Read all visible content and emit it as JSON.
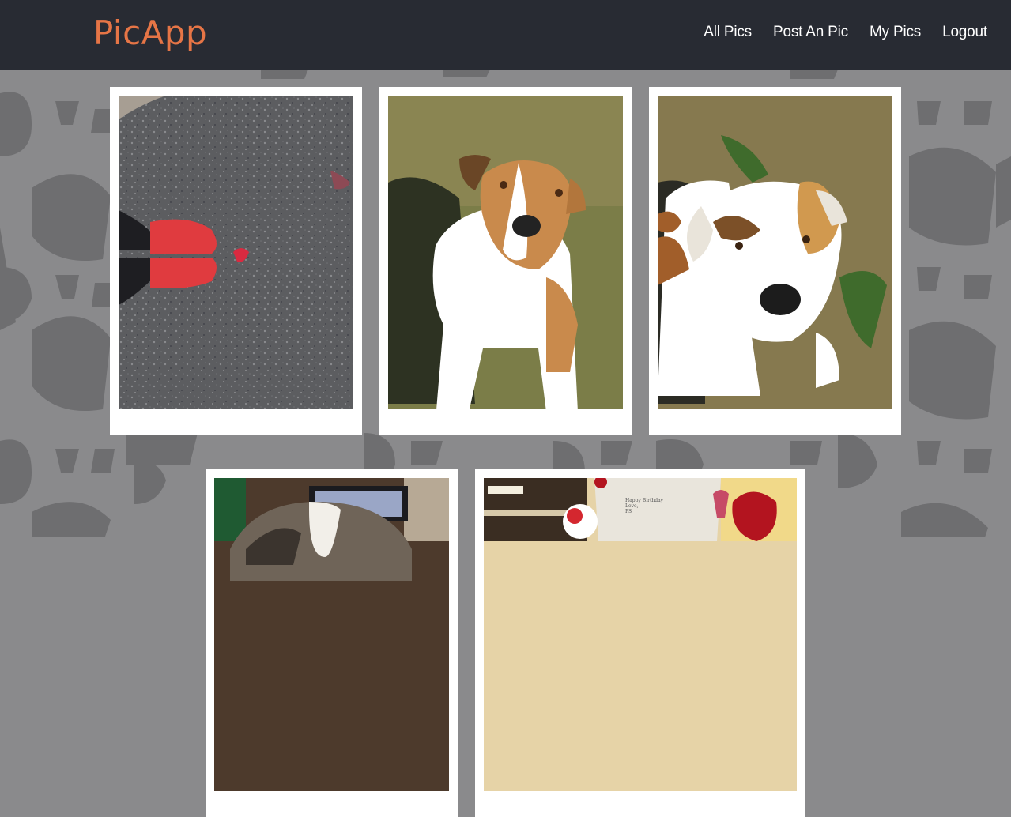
{
  "app": {
    "brand": "PicApp",
    "brand_color": "#e67546",
    "nav_bg": "#282b33",
    "page_bg": "#8a8a8c"
  },
  "nav": {
    "items": [
      {
        "label": "All Pics"
      },
      {
        "label": "Post An Pic"
      },
      {
        "label": "My Pics"
      },
      {
        "label": "Logout"
      }
    ]
  },
  "gallery": {
    "photos": [
      {
        "subject": "red-shoes-on-asphalt"
      },
      {
        "subject": "dog-sitting-on-grass"
      },
      {
        "subject": "dog-closeup-on-grass"
      },
      {
        "subject": "dog-in-living-room"
      },
      {
        "subject": "roses-and-birthday-card",
        "card_text": "Happy Birthday\nLove,\nPS"
      }
    ]
  }
}
